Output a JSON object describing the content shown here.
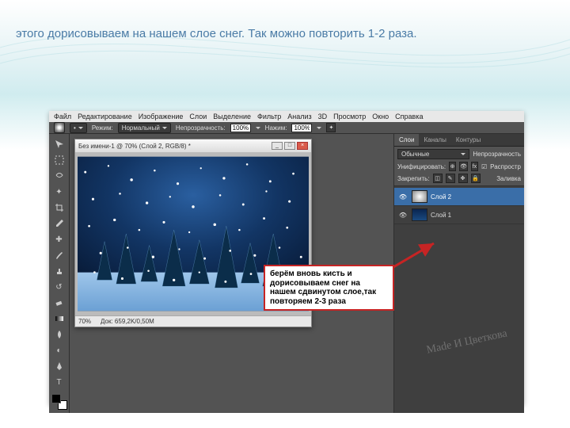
{
  "caption": "        этого дорисовываем на нашем слое снег. Так можно повторить                                             1-2                                                     раза.",
  "menu": [
    "Файл",
    "Редактирование",
    "Изображение",
    "Слои",
    "Выделение",
    "Фильтр",
    "Анализ",
    "3D",
    "Просмотр",
    "Окно",
    "Справка"
  ],
  "options": {
    "mode_label": "Режим:",
    "mode_value": "Нормальный",
    "opacity_label": "Непрозрачность:",
    "opacity_value": "100%",
    "flow_label": "Нажим:",
    "flow_value": "100%"
  },
  "document": {
    "title": "Без имени-1 @ 70% (Слой 2, RGB/8) *",
    "zoom": "70%",
    "doc_size": "Док: 659,2K/0,50M"
  },
  "callout_text": "берём вновь кисть и дорисовываем снег на нашем сдвинутом слое,так повторяем 2-3 раза",
  "panels": {
    "tabs": [
      "Слои",
      "Каналы",
      "Контуры"
    ],
    "blend_label": "Обычные",
    "opacity_panel_label": "Непрозрачность",
    "unify_label": "Унифицировать:",
    "spread_label": "Распростр",
    "lock_label": "Закрепить:",
    "fill_label": "Заливка"
  },
  "layers": [
    {
      "name": "Слой 2",
      "selected": true
    },
    {
      "name": "Слой 1",
      "selected": false
    }
  ],
  "watermark": "Made И Цветкова"
}
